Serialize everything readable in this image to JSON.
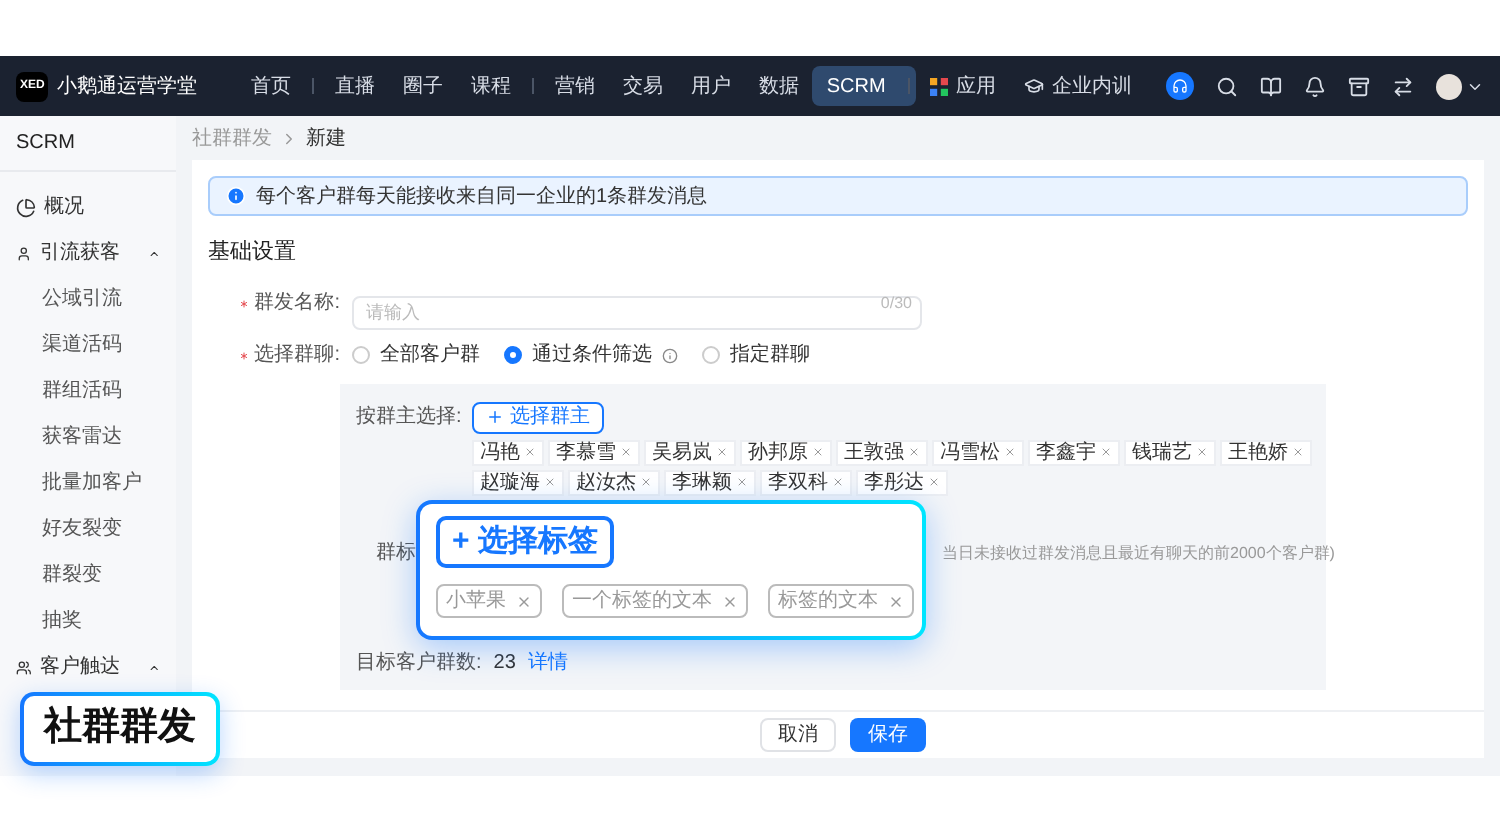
{
  "nav": {
    "logo": "XED",
    "brand": "小鹅通运营学堂",
    "items": [
      {
        "label": "首页",
        "selected": false,
        "kind": "plain",
        "divider_after": true
      },
      {
        "label": "直播",
        "selected": false,
        "kind": "plain",
        "divider_after": false
      },
      {
        "label": "圈子",
        "selected": false,
        "kind": "plain",
        "divider_after": false
      },
      {
        "label": "课程",
        "selected": false,
        "kind": "plain",
        "divider_after": true
      },
      {
        "label": "营销",
        "selected": false,
        "kind": "plain",
        "divider_after": false
      },
      {
        "label": "交易",
        "selected": false,
        "kind": "plain",
        "divider_after": false
      },
      {
        "label": "用户",
        "selected": false,
        "kind": "plain",
        "divider_after": false
      },
      {
        "label": "数据",
        "selected": false,
        "kind": "plain",
        "divider_after": false
      },
      {
        "label": "SCRM",
        "selected": true,
        "kind": "plain",
        "divider_after": true
      },
      {
        "label": "应用",
        "selected": false,
        "kind": "apps",
        "divider_after": false
      },
      {
        "label": "企业内训",
        "selected": false,
        "kind": "training",
        "divider_after": false
      }
    ]
  },
  "sidebar": {
    "title": "SCRM",
    "items": [
      {
        "label": "概况",
        "kind": "overview"
      },
      {
        "label": "引流获客",
        "kind": "users",
        "expanded": true,
        "children": [
          {
            "label": "公域引流"
          },
          {
            "label": "渠道活码"
          },
          {
            "label": "群组活码"
          },
          {
            "label": "获客雷达"
          },
          {
            "label": "批量加客户"
          },
          {
            "label": "好友裂变"
          },
          {
            "label": "群裂变"
          },
          {
            "label": "抽奖"
          }
        ]
      },
      {
        "label": "客户触达",
        "kind": "reach",
        "expanded": true
      }
    ]
  },
  "breadcrumb": [
    "社群群发",
    "新建"
  ],
  "alert": "每个客户群每天能接收来自同一企业的1条群发消息",
  "section_title": "基础设置",
  "name_field": {
    "label": "群发名称:",
    "required": true,
    "placeholder": "请输入",
    "counter": "0/30"
  },
  "chat_select": {
    "label": "选择群聊:",
    "required": true,
    "options": [
      {
        "label": "全部客户群",
        "selected": false,
        "info": false
      },
      {
        "label": "通过条件筛选",
        "selected": true,
        "info": true
      },
      {
        "label": "指定群聊",
        "selected": false,
        "info": false
      }
    ]
  },
  "owner_select": {
    "label": "按群主选择:",
    "button": "选择群主",
    "tags": [
      "冯艳",
      "李慕雪",
      "吴易岚",
      "孙邦原",
      "王敦强",
      "冯雪松",
      "李鑫宇",
      "钱瑞艺",
      "王艳娇",
      "赵璇海",
      "赵汝杰",
      "李琳颖",
      "李双科",
      "李彤达"
    ]
  },
  "tag_select": {
    "label": "群标",
    "hint": "当日未接收过群发消息且最近有聊天的前2000个客户群)"
  },
  "target": {
    "label": "目标客户群数:",
    "value": "23",
    "link": "详情"
  },
  "footer_buttons": [
    {
      "label": "取消",
      "kind": "secondary"
    },
    {
      "label": "保存",
      "kind": "primary"
    }
  ],
  "callout": {
    "button": "+ 选择标签",
    "tags": [
      "小苹果",
      "一个标签的文本",
      "标签的文本"
    ]
  },
  "badge": "社群群发"
}
